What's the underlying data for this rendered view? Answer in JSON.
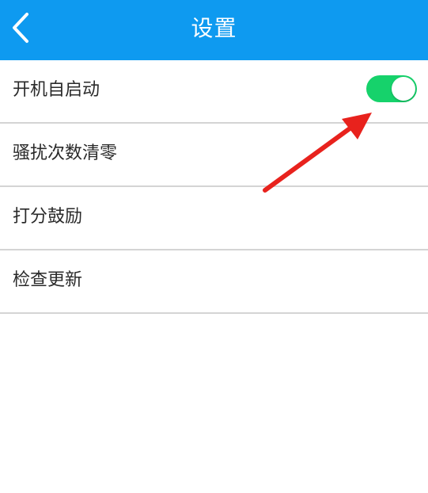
{
  "header": {
    "title": "设置",
    "back_icon": "chevron-left-icon",
    "background_color": "#0e9af0"
  },
  "settings": {
    "items": [
      {
        "label": "开机自启动",
        "has_toggle": true,
        "toggle_on": true
      },
      {
        "label": "骚扰次数清零"
      },
      {
        "label": "打分鼓励"
      },
      {
        "label": "检查更新"
      }
    ]
  },
  "colors": {
    "toggle_on": "#16d26b",
    "annotation_arrow": "#e8221d"
  }
}
